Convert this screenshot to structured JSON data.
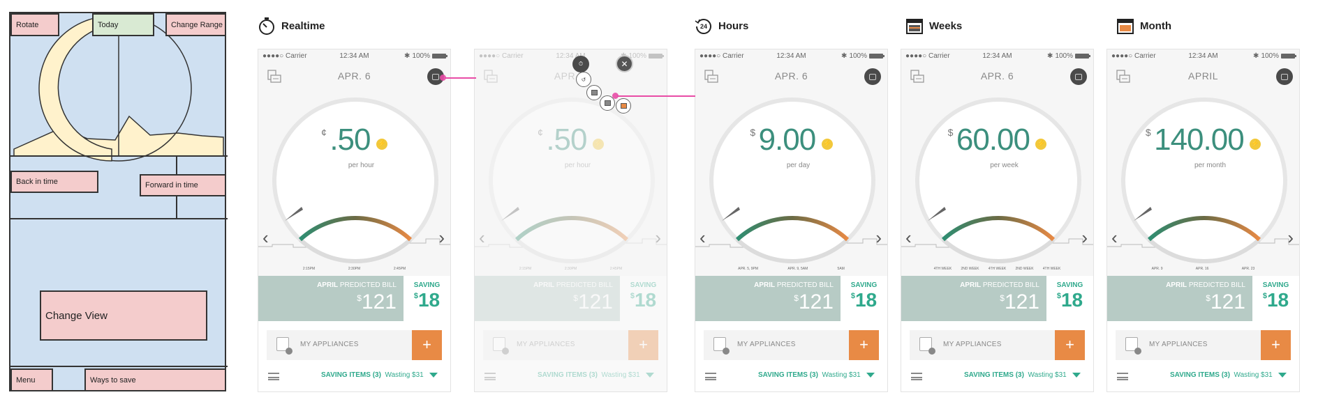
{
  "wireframe": {
    "labels": {
      "rotate": "Rotate",
      "today": "Today",
      "change_range": "Change Range",
      "back": "Back in time",
      "forward": "Forward in time",
      "change_view": "Change View",
      "menu": "Menu",
      "ways_to_save": "Ways to save"
    }
  },
  "colors": {
    "teal": "#3c8f7d",
    "accent_green": "#2fa98c",
    "orange": "#e88a45",
    "bill_bg": "#b7cbc5",
    "bolt_yellow": "#f2c83b",
    "connector_pink": "#e84ca6"
  },
  "status_bar": {
    "carrier": "●●●●○ Carrier",
    "time": "12:34 AM",
    "battery": "100%"
  },
  "screens": [
    {
      "heading": "Realtime",
      "heading_icon": "stopwatch-icon",
      "nav_title": "APR. 6",
      "currency": "¢",
      "value": ".50",
      "unit": "per hour",
      "ticks": [
        "2:15PM",
        "2:30PM",
        "2:45PM"
      ]
    },
    {
      "heading": "",
      "heading_icon": "",
      "nav_title": "APR. 6",
      "currency": "¢",
      "value": ".50",
      "unit": "per hour",
      "ticks": [
        "2:15PM",
        "2:30PM",
        "2:45PM"
      ]
    },
    {
      "heading": "Hours",
      "heading_icon": "24-hours-icon",
      "nav_title": "APR. 6",
      "currency": "$",
      "value": "9.00",
      "unit": "per day",
      "ticks": [
        "APR. 5, 9PM",
        "APR. 9, 5AM",
        "5AM"
      ]
    },
    {
      "heading": "Weeks",
      "heading_icon": "calendar-week-icon",
      "nav_title": "APR. 6",
      "currency": "$",
      "value": "60.00",
      "unit": "per week",
      "ticks": [
        "4TH WEEK",
        "2ND WEEK",
        "4TH WEEK",
        "2ND WEEK",
        "4TH WEEK"
      ]
    },
    {
      "heading": "Month",
      "heading_icon": "calendar-month-icon",
      "nav_title": "APRIL",
      "currency": "$",
      "value": "140.00",
      "unit": "per month",
      "ticks": [
        "APR. 9",
        "APR. 16",
        "APR. 23"
      ]
    }
  ],
  "bill": {
    "month": "APRIL",
    "label": "PREDICTED BILL",
    "currency": "$",
    "amount": "121"
  },
  "saving": {
    "label": "SAVING",
    "currency": "$",
    "amount": "18"
  },
  "appliances": {
    "label": "MY APPLIANCES",
    "add": "+"
  },
  "footer": {
    "saving_items": "SAVING ITEMS (3)",
    "wasting": "Wasting $31"
  },
  "popup": {
    "close": "✕"
  },
  "arrows": {
    "left": "‹",
    "right": "›"
  },
  "bolt": "⚡"
}
